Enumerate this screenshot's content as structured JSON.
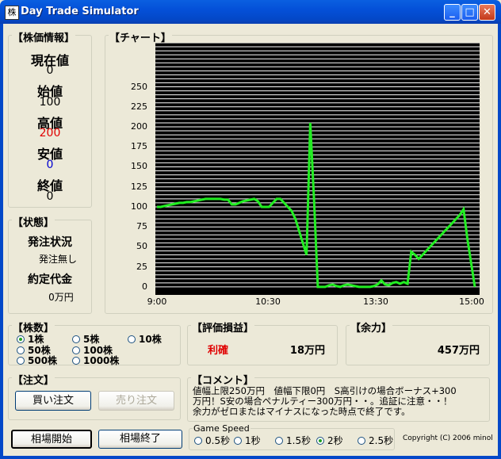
{
  "window": {
    "title": "Day Trade Simulator",
    "icon": "app-icon",
    "min": "_",
    "max": "□",
    "close": "✕"
  },
  "stock_info": {
    "title": "【株価情報】",
    "current_label": "現在値",
    "current_value": "0",
    "open_label": "始値",
    "open_value": "100",
    "high_label": "高値",
    "high_value": "200",
    "low_label": "安値",
    "low_value": "0",
    "close_label": "終値",
    "close_value": "0",
    "high_color": "#e00000",
    "low_color": "#0000d0"
  },
  "status": {
    "title": "【状態】",
    "order_label": "発注状況",
    "order_value": "発注無し",
    "contract_label": "約定代金",
    "contract_value": "0万円"
  },
  "chart": {
    "title": "【チャート】"
  },
  "chart_data": {
    "type": "line",
    "x_ticks": [
      "9:00",
      "10:30",
      "13:30",
      "15:00"
    ],
    "y_ticks": [
      250,
      225,
      200,
      175,
      150,
      125,
      100,
      75,
      50,
      25,
      0
    ],
    "ylim": [
      -10,
      305
    ],
    "grid": true,
    "line_color": "#22ee22",
    "values": [
      100,
      100,
      101,
      102,
      103,
      104,
      105,
      105,
      106,
      106,
      107,
      108,
      109,
      110,
      110,
      110,
      110,
      110,
      109,
      109,
      103,
      103,
      105,
      107,
      108,
      109,
      110,
      107,
      100,
      100,
      100,
      105,
      110,
      110,
      105,
      100,
      95,
      85,
      70,
      55,
      40,
      205,
      110,
      0,
      0,
      0,
      2,
      3,
      1,
      0,
      2,
      3,
      2,
      1,
      0,
      0,
      0,
      0,
      1,
      3,
      8,
      3,
      2,
      5,
      6,
      4,
      6,
      4,
      44,
      40,
      35,
      40,
      45,
      50,
      55,
      60,
      65,
      70,
      75,
      80,
      85,
      90,
      97,
      60,
      30,
      0
    ]
  },
  "shares": {
    "title": "【株数】",
    "options": [
      "1株",
      "5株",
      "10株",
      "50株",
      "100株",
      "500株",
      "1000株"
    ],
    "selected": "1株"
  },
  "pnl": {
    "title": "【評価損益】",
    "label": "利確",
    "value": "18万円",
    "label_color": "#e00000"
  },
  "margin": {
    "title": "【余力】",
    "value": "457万円"
  },
  "order": {
    "title": "【注文】",
    "buy_label": "買い注文",
    "sell_label": "売り注文"
  },
  "comment": {
    "title": "【コメント】",
    "line1": "値幅上限250万円　値幅下限0円　S高引けの場合ボーナス+300",
    "line2": "万円！S安の場合ペナルティー300万円・・。追証に注意・・！",
    "line3": "余力がゼロまたはマイナスになった時点で終了です。"
  },
  "controls": {
    "start_label": "相場開始",
    "end_label": "相場終了"
  },
  "game_speed": {
    "title": "Game Speed",
    "options": [
      "0.5秒",
      "1秒",
      "1.5秒",
      "2秒",
      "2.5秒"
    ],
    "selected": "2秒"
  },
  "copyright": "Copyright (C) 2006 minol"
}
